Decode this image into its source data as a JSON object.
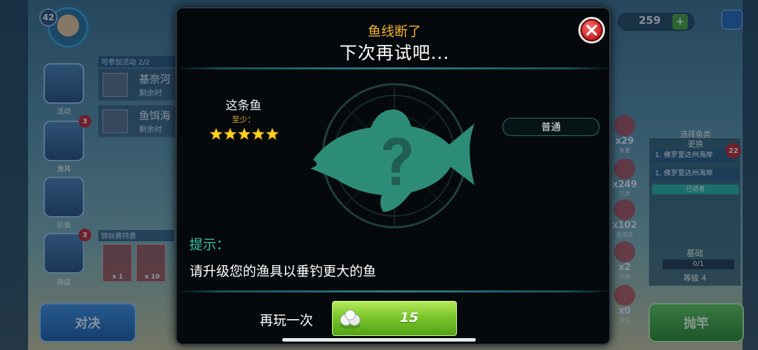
{
  "background": {
    "level": "42",
    "events_header": "可参加活动 2/2",
    "events": [
      {
        "title": "基奈河",
        "subtitle": "剩余时"
      },
      {
        "title": "鱼饵海",
        "subtitle": "剩余时"
      }
    ],
    "side_buttons": [
      {
        "label": "活动",
        "badge": ""
      },
      {
        "label": "渔具",
        "badge": "3"
      },
      {
        "label": "公会",
        "badge": ""
      },
      {
        "label": "商店",
        "badge": "3"
      }
    ],
    "tournament_header": "锦标赛特惠",
    "tournament_items": [
      "x 1",
      "x 10"
    ],
    "duel_label": "对决",
    "cast_label": "抛竿",
    "currency_value": "259",
    "currency_plus": "+",
    "gear": [
      {
        "count": "x29",
        "label": "鱼量"
      },
      {
        "count": "x249",
        "label": "几率"
      },
      {
        "count": "x102",
        "label": "鱼速度"
      },
      {
        "count": "x2",
        "label": "声纳"
      },
      {
        "count": "x0",
        "label": "幸运"
      }
    ],
    "location": {
      "title": "选择鱼类",
      "subtitle": "更换",
      "rows": [
        "1. 佛罗里达州海岸",
        "1. 佛罗里达州海岸"
      ],
      "selected": "已选者",
      "badge": "22",
      "base": "基础",
      "progress": "0/1",
      "grade": "等级 4"
    }
  },
  "modal": {
    "title": "鱼线断了",
    "subtitle": "下次再试吧...",
    "fish_label": "这条鱼",
    "min_label": "至少：",
    "stars": 5,
    "rarity": "普通",
    "hint_label": "提示：",
    "hint_text": "请升级您的渔具以垂钓更大的鱼",
    "replay_label": "再玩一次",
    "replay_cost": "15",
    "icons": {
      "close": "close-icon",
      "pearl": "pearl-icon",
      "star": "star-icon",
      "fish": "fish-silhouette-icon",
      "question": "question-mark-icon"
    },
    "colors": {
      "title": "#f3b227",
      "hint": "#2fc2a6",
      "silhouette": "#2d8c78",
      "replay_button": "#7bc52a"
    }
  }
}
